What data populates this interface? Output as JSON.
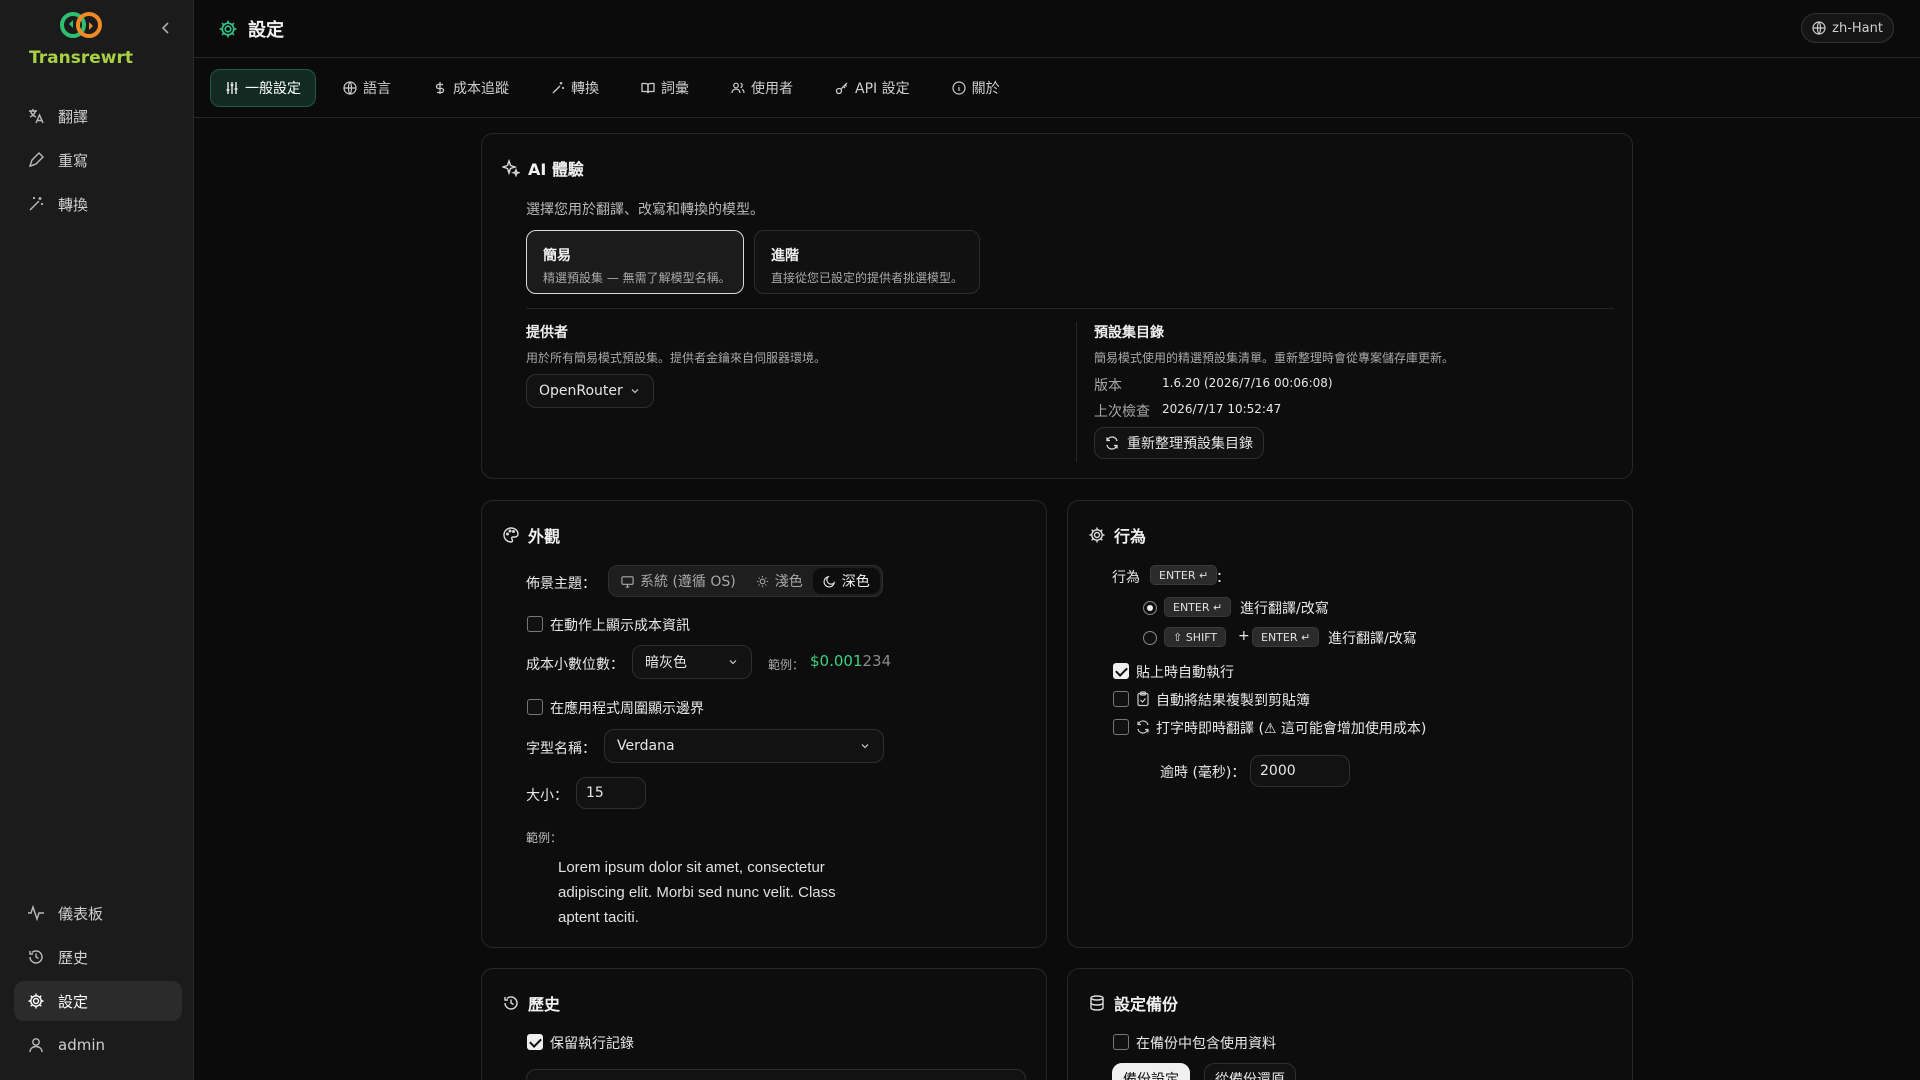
{
  "app": {
    "name": "Transrewrt"
  },
  "sidebar": {
    "top_items": [
      {
        "label": "翻譯",
        "icon": "translate-icon"
      },
      {
        "label": "重寫",
        "icon": "pen-icon"
      },
      {
        "label": "轉換",
        "icon": "wand-icon"
      }
    ],
    "bottom_items": [
      {
        "label": "儀表板",
        "icon": "activity-icon"
      },
      {
        "label": "歷史",
        "icon": "history-icon"
      },
      {
        "label": "設定",
        "icon": "gear-icon",
        "active": true
      },
      {
        "label": "admin",
        "icon": "user-icon"
      }
    ]
  },
  "header": {
    "title": "設定",
    "language": "zh-Hant"
  },
  "tabs": [
    {
      "label": "一般設定",
      "active": true
    },
    {
      "label": "語言"
    },
    {
      "label": "成本追蹤"
    },
    {
      "label": "轉換"
    },
    {
      "label": "詞彙"
    },
    {
      "label": "使用者"
    },
    {
      "label": "API 設定"
    },
    {
      "label": "關於"
    }
  ],
  "ai": {
    "title": "AI 體驗",
    "description": "選擇您用於翻譯、改寫和轉換的模型。",
    "modes": [
      {
        "title": "簡易",
        "desc": "精選預設集 — 無需了解模型名稱。",
        "selected": true
      },
      {
        "title": "進階",
        "desc": "直接從您已設定的提供者挑選模型。"
      }
    ],
    "provider_label": "提供者",
    "provider_desc": "用於所有簡易模式預設集。提供者金鑰來自伺服器環境。",
    "provider_value": "OpenRouter",
    "catalog_label": "預設集目錄",
    "catalog_desc": "簡易模式使用的精選預設集清單。重新整理時會從專案儲存庫更新。",
    "version_label": "版本",
    "version_value": "1.6.20 (2026/7/16 00:06:08)",
    "last_check_label": "上次檢查",
    "last_check_value": "2026/7/17 10:52:47",
    "refresh_label": "重新整理預設集目錄"
  },
  "appearance": {
    "title": "外觀",
    "theme_label": "佈景主題：",
    "theme_options": [
      {
        "label": "系統 (遵循 OS)",
        "icon": "monitor-icon"
      },
      {
        "label": "淺色",
        "icon": "sun-icon"
      },
      {
        "label": "深色",
        "icon": "moon-icon",
        "active": true
      }
    ],
    "show_cost_label": "在動作上顯示成本資訊",
    "show_cost_checked": false,
    "decimals_label": "成本小數位數：",
    "decimals_value": "暗灰色",
    "example_label": "範例：",
    "example_value_bright": "$0.001",
    "example_value_dim": "234",
    "show_border_label": "在應用程式周圍顯示邊界",
    "show_border_checked": false,
    "font_label": "字型名稱：",
    "font_value": "Verdana",
    "size_label": "大小：",
    "size_value": "15",
    "sample_label": "範例：",
    "sample_lines": [
      "Lorem ipsum dolor sit amet, consectetur",
      "adipiscing elit. Morbi sed nunc velit. Class",
      "aptent taciti."
    ]
  },
  "behavior": {
    "title": "行為",
    "prefix": "行為",
    "key_enter": "ENTER ↵",
    "colon": "：",
    "option1_label": "進行翻譯/改寫",
    "option2_shift": "⇧ SHIFT",
    "plus": "+",
    "option2_label": "進行翻譯/改寫",
    "auto_run_label": "貼上時自動執行",
    "auto_run_checked": true,
    "copy_label": "自動將結果複製到剪貼簿",
    "copy_checked": false,
    "live_label": "打字時即時翻譯 (⚠ 這可能會增加使用成本)",
    "live_checked": false,
    "timeout_label": "逾時 (毫秒)：",
    "timeout_value": "2000"
  },
  "history": {
    "title": "歷史",
    "keep_label": "保留執行記錄",
    "keep_checked": true
  },
  "backup": {
    "title": "設定備份",
    "include_usage_label": "在備份中包含使用資料",
    "include_usage_checked": false,
    "backup_btn": "備份設定",
    "restore_btn": "從備份還原"
  }
}
